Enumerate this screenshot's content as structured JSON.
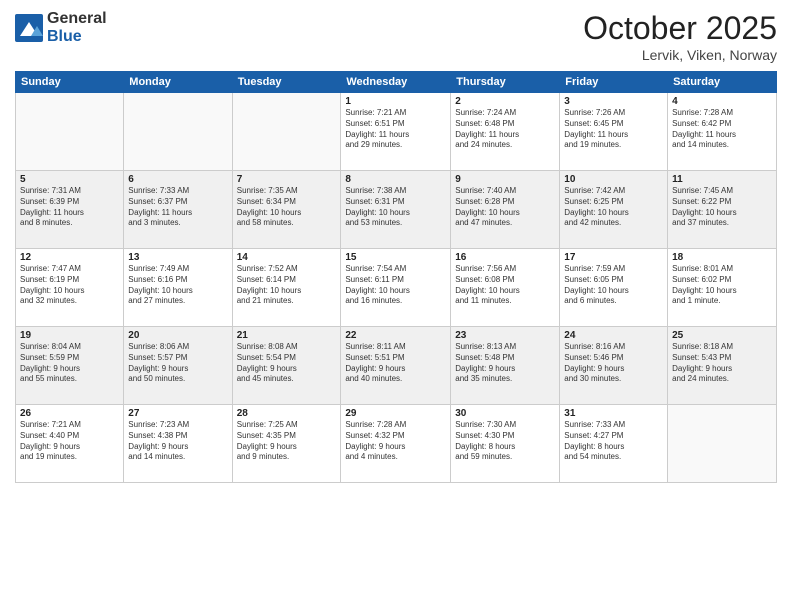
{
  "logo": {
    "general": "General",
    "blue": "Blue"
  },
  "header": {
    "month": "October 2025",
    "location": "Lervik, Viken, Norway"
  },
  "days_of_week": [
    "Sunday",
    "Monday",
    "Tuesday",
    "Wednesday",
    "Thursday",
    "Friday",
    "Saturday"
  ],
  "weeks": [
    [
      {
        "day": "",
        "info": ""
      },
      {
        "day": "",
        "info": ""
      },
      {
        "day": "",
        "info": ""
      },
      {
        "day": "1",
        "info": "Sunrise: 7:21 AM\nSunset: 6:51 PM\nDaylight: 11 hours\nand 29 minutes."
      },
      {
        "day": "2",
        "info": "Sunrise: 7:24 AM\nSunset: 6:48 PM\nDaylight: 11 hours\nand 24 minutes."
      },
      {
        "day": "3",
        "info": "Sunrise: 7:26 AM\nSunset: 6:45 PM\nDaylight: 11 hours\nand 19 minutes."
      },
      {
        "day": "4",
        "info": "Sunrise: 7:28 AM\nSunset: 6:42 PM\nDaylight: 11 hours\nand 14 minutes."
      }
    ],
    [
      {
        "day": "5",
        "info": "Sunrise: 7:31 AM\nSunset: 6:39 PM\nDaylight: 11 hours\nand 8 minutes."
      },
      {
        "day": "6",
        "info": "Sunrise: 7:33 AM\nSunset: 6:37 PM\nDaylight: 11 hours\nand 3 minutes."
      },
      {
        "day": "7",
        "info": "Sunrise: 7:35 AM\nSunset: 6:34 PM\nDaylight: 10 hours\nand 58 minutes."
      },
      {
        "day": "8",
        "info": "Sunrise: 7:38 AM\nSunset: 6:31 PM\nDaylight: 10 hours\nand 53 minutes."
      },
      {
        "day": "9",
        "info": "Sunrise: 7:40 AM\nSunset: 6:28 PM\nDaylight: 10 hours\nand 47 minutes."
      },
      {
        "day": "10",
        "info": "Sunrise: 7:42 AM\nSunset: 6:25 PM\nDaylight: 10 hours\nand 42 minutes."
      },
      {
        "day": "11",
        "info": "Sunrise: 7:45 AM\nSunset: 6:22 PM\nDaylight: 10 hours\nand 37 minutes."
      }
    ],
    [
      {
        "day": "12",
        "info": "Sunrise: 7:47 AM\nSunset: 6:19 PM\nDaylight: 10 hours\nand 32 minutes."
      },
      {
        "day": "13",
        "info": "Sunrise: 7:49 AM\nSunset: 6:16 PM\nDaylight: 10 hours\nand 27 minutes."
      },
      {
        "day": "14",
        "info": "Sunrise: 7:52 AM\nSunset: 6:14 PM\nDaylight: 10 hours\nand 21 minutes."
      },
      {
        "day": "15",
        "info": "Sunrise: 7:54 AM\nSunset: 6:11 PM\nDaylight: 10 hours\nand 16 minutes."
      },
      {
        "day": "16",
        "info": "Sunrise: 7:56 AM\nSunset: 6:08 PM\nDaylight: 10 hours\nand 11 minutes."
      },
      {
        "day": "17",
        "info": "Sunrise: 7:59 AM\nSunset: 6:05 PM\nDaylight: 10 hours\nand 6 minutes."
      },
      {
        "day": "18",
        "info": "Sunrise: 8:01 AM\nSunset: 6:02 PM\nDaylight: 10 hours\nand 1 minute."
      }
    ],
    [
      {
        "day": "19",
        "info": "Sunrise: 8:04 AM\nSunset: 5:59 PM\nDaylight: 9 hours\nand 55 minutes."
      },
      {
        "day": "20",
        "info": "Sunrise: 8:06 AM\nSunset: 5:57 PM\nDaylight: 9 hours\nand 50 minutes."
      },
      {
        "day": "21",
        "info": "Sunrise: 8:08 AM\nSunset: 5:54 PM\nDaylight: 9 hours\nand 45 minutes."
      },
      {
        "day": "22",
        "info": "Sunrise: 8:11 AM\nSunset: 5:51 PM\nDaylight: 9 hours\nand 40 minutes."
      },
      {
        "day": "23",
        "info": "Sunrise: 8:13 AM\nSunset: 5:48 PM\nDaylight: 9 hours\nand 35 minutes."
      },
      {
        "day": "24",
        "info": "Sunrise: 8:16 AM\nSunset: 5:46 PM\nDaylight: 9 hours\nand 30 minutes."
      },
      {
        "day": "25",
        "info": "Sunrise: 8:18 AM\nSunset: 5:43 PM\nDaylight: 9 hours\nand 24 minutes."
      }
    ],
    [
      {
        "day": "26",
        "info": "Sunrise: 7:21 AM\nSunset: 4:40 PM\nDaylight: 9 hours\nand 19 minutes."
      },
      {
        "day": "27",
        "info": "Sunrise: 7:23 AM\nSunset: 4:38 PM\nDaylight: 9 hours\nand 14 minutes."
      },
      {
        "day": "28",
        "info": "Sunrise: 7:25 AM\nSunset: 4:35 PM\nDaylight: 9 hours\nand 9 minutes."
      },
      {
        "day": "29",
        "info": "Sunrise: 7:28 AM\nSunset: 4:32 PM\nDaylight: 9 hours\nand 4 minutes."
      },
      {
        "day": "30",
        "info": "Sunrise: 7:30 AM\nSunset: 4:30 PM\nDaylight: 8 hours\nand 59 minutes."
      },
      {
        "day": "31",
        "info": "Sunrise: 7:33 AM\nSunset: 4:27 PM\nDaylight: 8 hours\nand 54 minutes."
      },
      {
        "day": "",
        "info": ""
      }
    ]
  ]
}
